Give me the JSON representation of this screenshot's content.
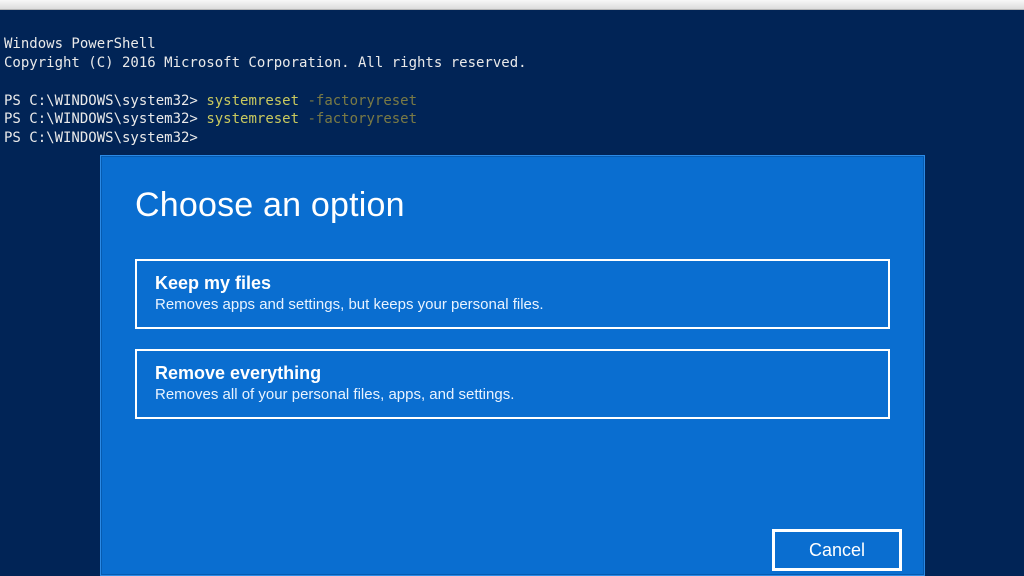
{
  "terminal": {
    "banner_line1": "Windows PowerShell",
    "banner_line2": "Copyright (C) 2016 Microsoft Corporation. All rights reserved.",
    "lines": [
      {
        "prompt": "PS C:\\WINDOWS\\system32>",
        "cmd": "systemreset",
        "flag": "-factoryreset"
      },
      {
        "prompt": "PS C:\\WINDOWS\\system32>",
        "cmd": "systemreset",
        "flag": "-factoryreset"
      },
      {
        "prompt": "PS C:\\WINDOWS\\system32>",
        "cmd": "",
        "flag": ""
      }
    ]
  },
  "dialog": {
    "title": "Choose an option",
    "options": [
      {
        "title": "Keep my files",
        "desc": "Removes apps and settings, but keeps your personal files."
      },
      {
        "title": "Remove everything",
        "desc": "Removes all of your personal files, apps, and settings."
      }
    ],
    "cancel_label": "Cancel"
  }
}
